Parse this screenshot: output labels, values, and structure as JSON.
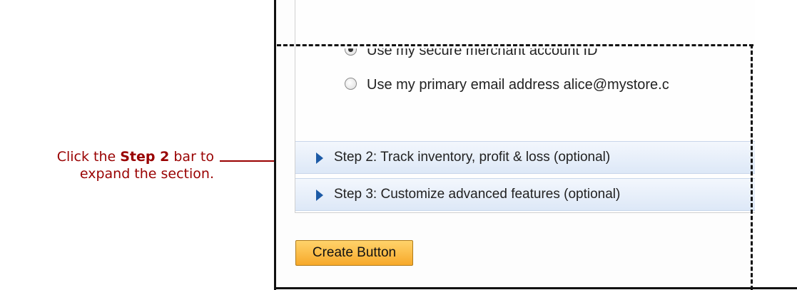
{
  "annotation": {
    "line1_prefix": "Click the ",
    "line1_bold": "Step 2",
    "line1_suffix": " bar to",
    "line2": "expand the section.",
    "color": "#990000"
  },
  "form": {
    "options": [
      {
        "label": "Use my secure merchant account ID",
        "checked": true
      },
      {
        "label": "Use my primary email address alice@mystore.c",
        "checked": false
      }
    ],
    "steps": [
      {
        "label": "Step 2: Track inventory, profit & loss (optional)",
        "icon": "expand-triangle-icon"
      },
      {
        "label": "Step 3: Customize advanced features (optional)",
        "icon": "expand-triangle-icon"
      }
    ],
    "create_button": "Create Button"
  },
  "colors": {
    "step_bar_top": "#f3f7fd",
    "step_bar_bottom": "#dde8f7",
    "step_arrow": "#1c5aa6",
    "button_top": "#ffd36b",
    "button_bottom": "#f7a92a"
  }
}
